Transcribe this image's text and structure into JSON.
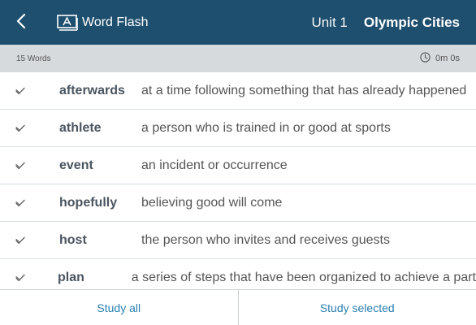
{
  "header": {
    "back_icon": "chevron-left-icon",
    "app_icon": "flashcard-icon",
    "app_title": "Word Flash",
    "unit": "Unit 1",
    "lesson": "Olympic Cities"
  },
  "subbar": {
    "word_count": "15 Words",
    "timer_icon": "clock-icon",
    "elapsed": "0m 0s"
  },
  "words": [
    {
      "word": "afterwards",
      "definition": "at a time following something that has already happened",
      "checked": true
    },
    {
      "word": "athlete",
      "definition": "a person who is trained in or good at sports",
      "checked": true
    },
    {
      "word": "event",
      "definition": "an incident or occurrence",
      "checked": true
    },
    {
      "word": "hopefully",
      "definition": "believing good will come",
      "checked": true
    },
    {
      "word": "host",
      "definition": "the person who invites and receives guests",
      "checked": true
    },
    {
      "word": "plan",
      "definition": "a series of steps that have been organized to achieve a part",
      "checked": true
    }
  ],
  "footer": {
    "study_all": "Study all",
    "study_selected": "Study selected"
  },
  "colors": {
    "header_bg": "#1f4f6e",
    "subbar_bg": "#d7dadd",
    "accent": "#2a7fb0"
  }
}
